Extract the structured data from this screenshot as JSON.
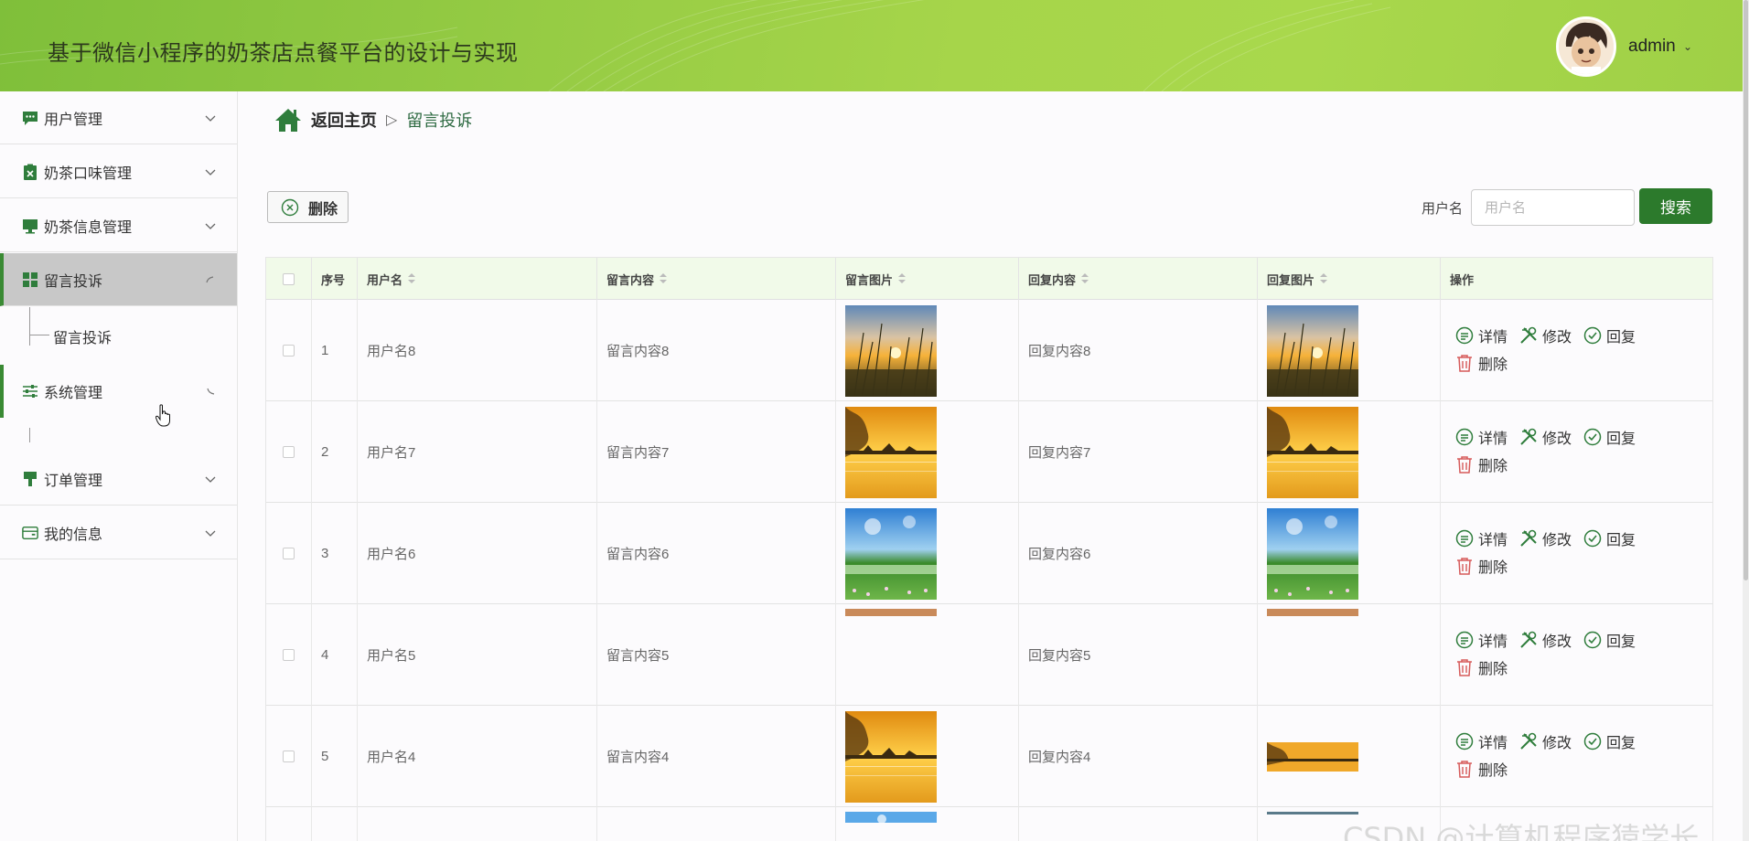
{
  "header": {
    "title": "基于微信小程序的奶茶店点餐平台的设计与实现",
    "username": "admin",
    "caret": "⌄"
  },
  "sidebar": {
    "items": [
      {
        "label": "用户管理",
        "icon": "chat-icon"
      },
      {
        "label": "奶茶口味管理",
        "icon": "clipboard-x-icon"
      },
      {
        "label": "奶茶信息管理",
        "icon": "monitor-icon"
      },
      {
        "label": "留言投诉",
        "icon": "grid-icon",
        "active": true,
        "sub": [
          "留言投诉"
        ]
      },
      {
        "label": "系统管理",
        "icon": "sliders-icon"
      },
      {
        "label": "订单管理",
        "icon": "brush-icon"
      },
      {
        "label": "我的信息",
        "icon": "card-icon"
      }
    ]
  },
  "breadcrumb": {
    "home": "返回主页",
    "sep": "▷",
    "current": "留言投诉"
  },
  "toolbar": {
    "delete_label": "删除",
    "search_label": "用户名",
    "search_placeholder": "用户名",
    "search_button": "搜索"
  },
  "table": {
    "headers": [
      "序号",
      "用户名",
      "留言内容",
      "留言图片",
      "回复内容",
      "回复图片",
      "操作"
    ],
    "rows": [
      {
        "idx": "1",
        "user": "用户名8",
        "msg": "留言内容8",
        "reply": "回复内容8",
        "img": "sunset-grass",
        "rimg": "sunset-grass"
      },
      {
        "idx": "2",
        "user": "用户名7",
        "msg": "留言内容7",
        "reply": "回复内容7",
        "img": "orange-lake",
        "rimg": "orange-lake"
      },
      {
        "idx": "3",
        "user": "用户名6",
        "msg": "留言内容6",
        "reply": "回复内容6",
        "img": "blue-meadow",
        "rimg": "blue-meadow"
      },
      {
        "idx": "4",
        "user": "用户名5",
        "msg": "留言内容5",
        "reply": "回复内容5",
        "img": "strip",
        "rimg": "strip"
      },
      {
        "idx": "5",
        "user": "用户名4",
        "msg": "留言内容4",
        "reply": "回复内容4",
        "img": "orange-lake",
        "rimg": "orange-lake-partial"
      }
    ],
    "actions": {
      "detail": "详情",
      "edit": "修改",
      "reply": "回复",
      "delete": "删除"
    }
  },
  "watermark": "CSDN @计算机程序猿学长",
  "colors": {
    "brand_green": "#2c7a2c",
    "header_green": "#a6d54a",
    "table_header_bg": "#f1fae9",
    "icon_green": "#2f7d3c",
    "delete_red": "#d65a5a"
  }
}
